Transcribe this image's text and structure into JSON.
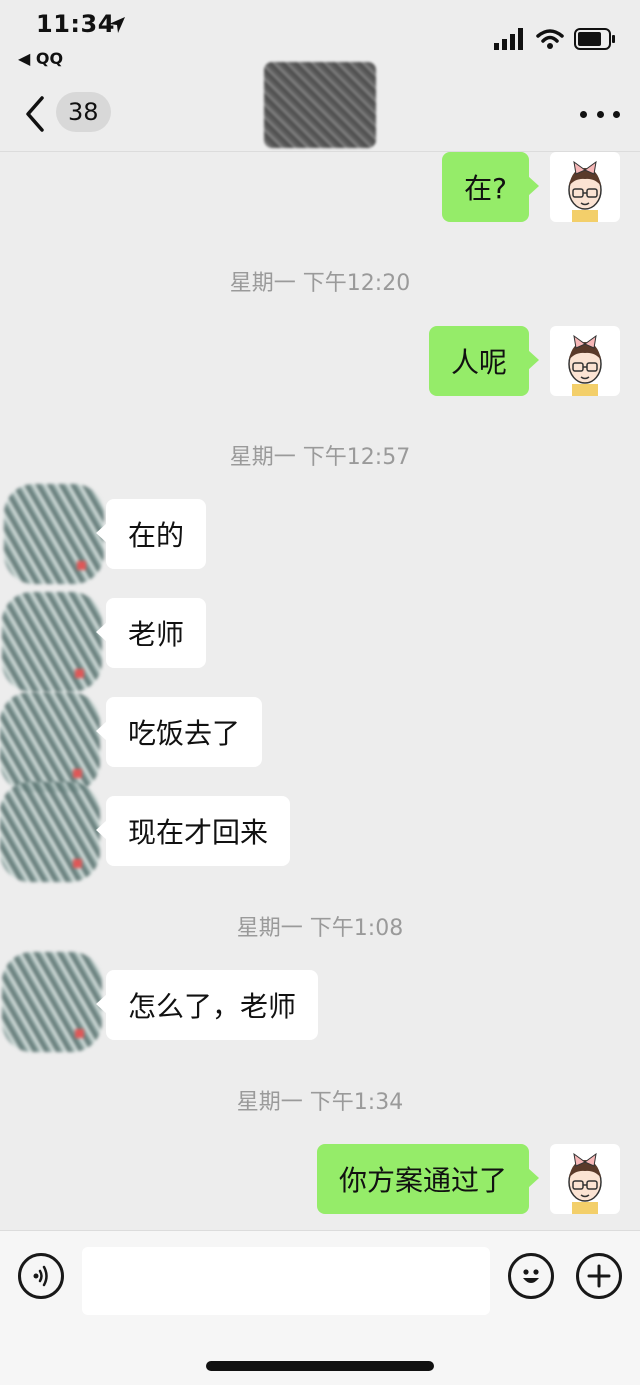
{
  "status_bar": {
    "time": "11:34",
    "back_app": "◀ QQ"
  },
  "nav": {
    "unread_count": "38"
  },
  "messages": [
    {
      "from": "me",
      "text": "在?"
    },
    {
      "type": "timestamp",
      "text": "星期一 下午12:20"
    },
    {
      "from": "me",
      "text": "人呢"
    },
    {
      "type": "timestamp",
      "text": "星期一 下午12:57"
    },
    {
      "from": "them",
      "text": "在的"
    },
    {
      "from": "them",
      "text": "老师"
    },
    {
      "from": "them",
      "text": "吃饭去了"
    },
    {
      "from": "them",
      "text": "现在才回来"
    },
    {
      "type": "timestamp",
      "text": "星期一 下午1:08"
    },
    {
      "from": "them",
      "text": "怎么了，老师"
    },
    {
      "type": "timestamp",
      "text": "星期一 下午1:34"
    },
    {
      "from": "me",
      "text": "你方案通过了"
    }
  ],
  "input": {
    "value": "",
    "placeholder": ""
  },
  "icons": {
    "location": "location-arrow-icon",
    "signal": "cellular-signal-icon",
    "wifi": "wifi-icon",
    "battery": "battery-icon",
    "back": "chevron-left-icon",
    "more": "more-dots-icon",
    "voice": "voice-icon",
    "emoji": "emoji-icon",
    "add": "plus-icon"
  },
  "colors": {
    "outgoing_bubble": "#95ec69",
    "incoming_bubble": "#ffffff",
    "chat_background": "#ededed",
    "timestamp": "#9a9a9a"
  }
}
